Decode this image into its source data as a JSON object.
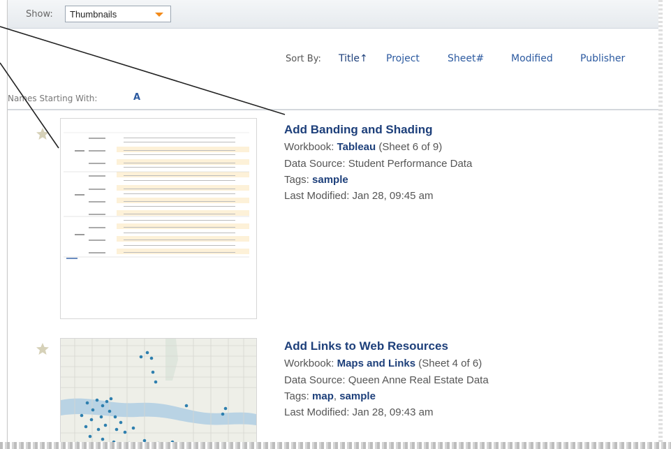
{
  "toolbar": {
    "show_label": "Show:",
    "show_value": "Thumbnails"
  },
  "sort": {
    "label": "Sort By:",
    "items": [
      "Title",
      "Project",
      "Sheet#",
      "Modified",
      "Publisher"
    ],
    "active_arrow": "↑"
  },
  "filter": {
    "label": "Names Starting With:",
    "letter": "A"
  },
  "results": [
    {
      "title": "Add Banding and Shading",
      "workbook_label": "Workbook:",
      "workbook": "Tableau",
      "sheet_info": "(Sheet 6 of 9)",
      "datasource": "Data Source: Student Performance Data",
      "tags_label": "Tags:",
      "tags": [
        "sample"
      ],
      "modified": "Last Modified: Jan 28, 09:45 am"
    },
    {
      "title": "Add Links to Web Resources",
      "workbook_label": "Workbook:",
      "workbook": "Maps and Links",
      "sheet_info": "(Sheet 4 of 6)",
      "datasource": "Data Source: Queen Anne Real Estate Data",
      "tags_label": "Tags:",
      "tags": [
        "map",
        "sample"
      ],
      "modified": "Last Modified: Jan 28, 09:43 am"
    }
  ],
  "colors": {
    "link": "#1d3f7a",
    "sort_link": "#2c5aa0",
    "caret": "#f28a1a",
    "star": "#d6d1b8"
  },
  "icons": [
    "star-icon",
    "dropdown-caret-icon",
    "sort-ascending-icon"
  ]
}
